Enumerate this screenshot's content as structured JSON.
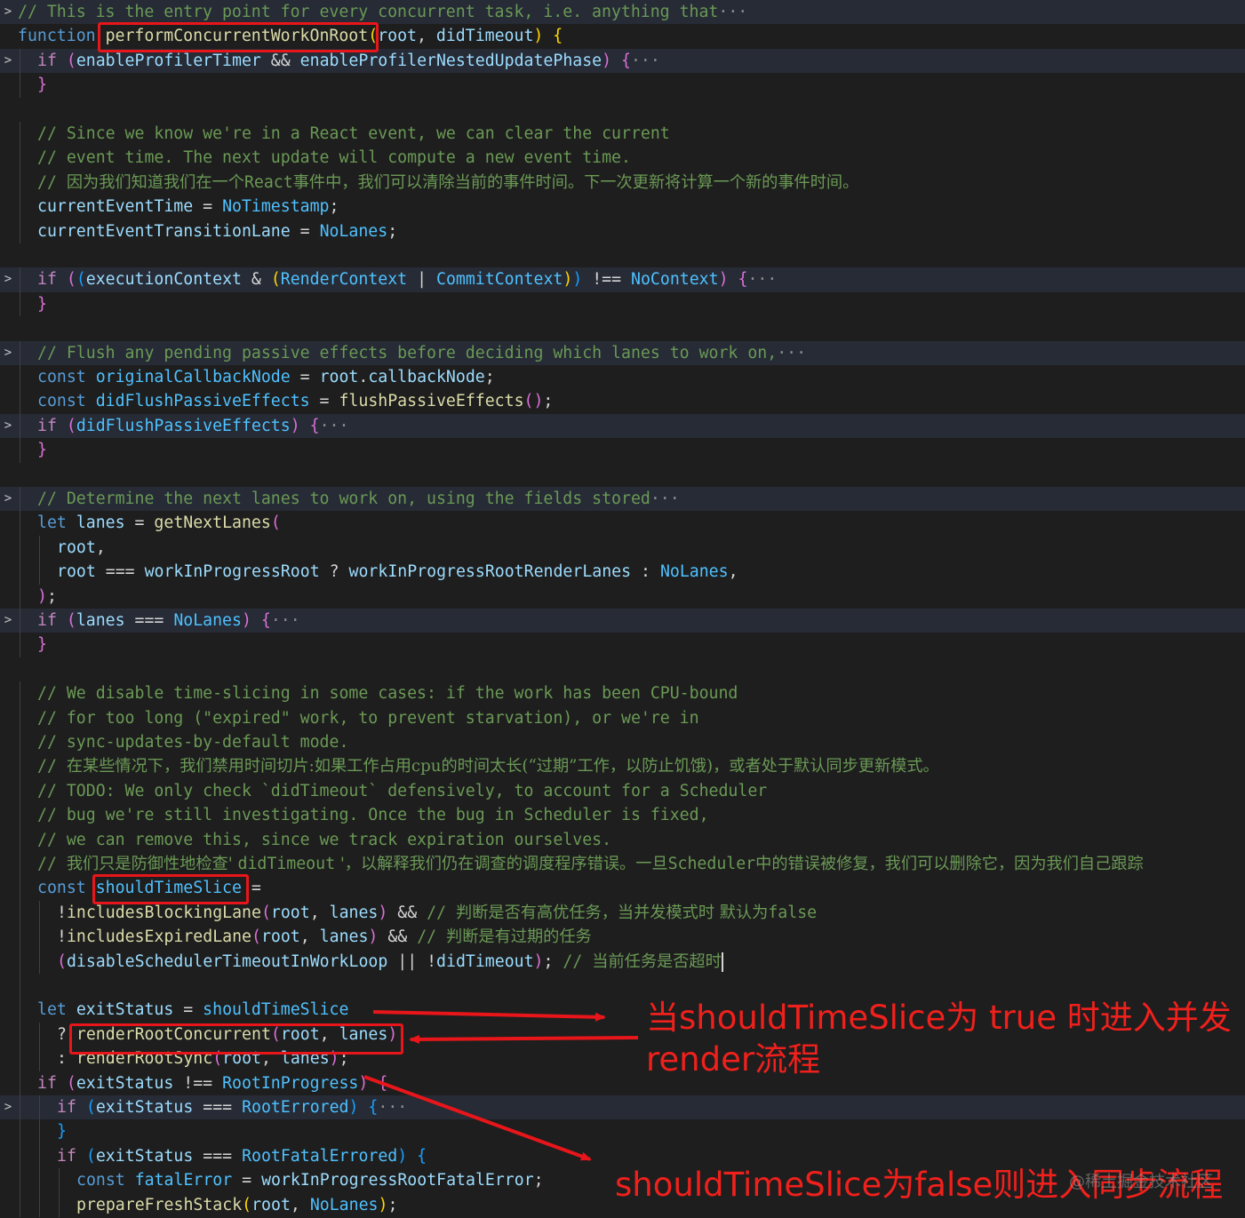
{
  "editor": {
    "lines": [
      {
        "gutter": ">",
        "fold": true,
        "indent": 0,
        "segments": [
          [
            "c",
            "// This is the entry point for every concurrent task, i.e. anything that"
          ],
          [
            "ell",
            "···"
          ]
        ]
      },
      {
        "gutter": "",
        "indent": 0,
        "segments": [
          [
            "k",
            "function "
          ],
          [
            "fn",
            "performConcurrentWorkOnRoot"
          ],
          [
            "b1",
            "("
          ],
          [
            "v",
            "root"
          ],
          [
            "p",
            ", "
          ],
          [
            "v",
            "didTimeout"
          ],
          [
            "b1",
            ")"
          ],
          [
            "p",
            " "
          ],
          [
            "b1",
            "{"
          ]
        ]
      },
      {
        "gutter": ">",
        "fold": true,
        "indent": 1,
        "segments": [
          [
            "kc",
            "if "
          ],
          [
            "b2",
            "("
          ],
          [
            "v",
            "enableProfilerTimer"
          ],
          [
            "p",
            " && "
          ],
          [
            "v",
            "enableProfilerNestedUpdatePhase"
          ],
          [
            "b2",
            ")"
          ],
          [
            "p",
            " "
          ],
          [
            "b2",
            "{"
          ],
          [
            "ell",
            "···"
          ]
        ]
      },
      {
        "gutter": "",
        "indent": 1,
        "segments": [
          [
            "b2",
            "}"
          ]
        ]
      },
      {
        "gutter": "",
        "indent": 0,
        "segments": []
      },
      {
        "gutter": "",
        "indent": 1,
        "segments": [
          [
            "c",
            "// Since we know we're in a React event, we can clear the current"
          ]
        ]
      },
      {
        "gutter": "",
        "indent": 1,
        "segments": [
          [
            "c",
            "// event time. The next update will compute a new event time."
          ]
        ]
      },
      {
        "gutter": "",
        "indent": 1,
        "segments": [
          [
            "c",
            "// "
          ],
          [
            "cz",
            "因为我们知道我们在一个"
          ],
          [
            "c",
            "React"
          ],
          [
            "cz",
            "事件中，我们可以清除当前的事件时间。下一次更新将计算一个新的事件时间。"
          ]
        ]
      },
      {
        "gutter": "",
        "indent": 1,
        "segments": [
          [
            "v",
            "currentEventTime"
          ],
          [
            "p",
            " = "
          ],
          [
            "cn",
            "NoTimestamp"
          ],
          [
            "p",
            ";"
          ]
        ]
      },
      {
        "gutter": "",
        "indent": 1,
        "segments": [
          [
            "v",
            "currentEventTransitionLane"
          ],
          [
            "p",
            " = "
          ],
          [
            "cn",
            "NoLanes"
          ],
          [
            "p",
            ";"
          ]
        ]
      },
      {
        "gutter": "",
        "indent": 0,
        "segments": []
      },
      {
        "gutter": ">",
        "fold": true,
        "indent": 1,
        "segments": [
          [
            "kc",
            "if "
          ],
          [
            "b2",
            "("
          ],
          [
            "b3",
            "("
          ],
          [
            "v",
            "executionContext"
          ],
          [
            "p",
            " & "
          ],
          [
            "b1",
            "("
          ],
          [
            "cn",
            "RenderContext"
          ],
          [
            "p",
            " | "
          ],
          [
            "cn",
            "CommitContext"
          ],
          [
            "b1",
            ")"
          ],
          [
            "b3",
            ")"
          ],
          [
            "p",
            " !== "
          ],
          [
            "cn",
            "NoContext"
          ],
          [
            "b2",
            ")"
          ],
          [
            "p",
            " "
          ],
          [
            "b2",
            "{"
          ],
          [
            "ell",
            "···"
          ]
        ]
      },
      {
        "gutter": "",
        "indent": 1,
        "segments": [
          [
            "b2",
            "}"
          ]
        ]
      },
      {
        "gutter": "",
        "indent": 0,
        "segments": []
      },
      {
        "gutter": ">",
        "fold": true,
        "indent": 1,
        "segments": [
          [
            "c",
            "// Flush any pending passive effects before deciding which lanes to work on,"
          ],
          [
            "ell",
            "···"
          ]
        ]
      },
      {
        "gutter": "",
        "indent": 1,
        "segments": [
          [
            "k",
            "const "
          ],
          [
            "cn",
            "originalCallbackNode"
          ],
          [
            "p",
            " = "
          ],
          [
            "v",
            "root"
          ],
          [
            "p",
            "."
          ],
          [
            "v",
            "callbackNode"
          ],
          [
            "p",
            ";"
          ]
        ]
      },
      {
        "gutter": "",
        "indent": 1,
        "segments": [
          [
            "k",
            "const "
          ],
          [
            "cn",
            "didFlushPassiveEffects"
          ],
          [
            "p",
            " = "
          ],
          [
            "fn",
            "flushPassiveEffects"
          ],
          [
            "b2",
            "()"
          ],
          [
            "p",
            ";"
          ]
        ]
      },
      {
        "gutter": ">",
        "fold": true,
        "indent": 1,
        "segments": [
          [
            "kc",
            "if "
          ],
          [
            "b2",
            "("
          ],
          [
            "cn",
            "didFlushPassiveEffects"
          ],
          [
            "b2",
            ")"
          ],
          [
            "p",
            " "
          ],
          [
            "b2",
            "{"
          ],
          [
            "ell",
            "···"
          ]
        ]
      },
      {
        "gutter": "",
        "indent": 1,
        "segments": [
          [
            "b2",
            "}"
          ]
        ]
      },
      {
        "gutter": "",
        "indent": 0,
        "segments": []
      },
      {
        "gutter": ">",
        "fold": true,
        "indent": 1,
        "segments": [
          [
            "c",
            "// Determine the next lanes to work on, using the fields stored"
          ],
          [
            "ell",
            "···"
          ]
        ]
      },
      {
        "gutter": "",
        "indent": 1,
        "segments": [
          [
            "k",
            "let "
          ],
          [
            "v",
            "lanes"
          ],
          [
            "p",
            " = "
          ],
          [
            "fn",
            "getNextLanes"
          ],
          [
            "b2",
            "("
          ]
        ]
      },
      {
        "gutter": "",
        "indent": 2,
        "segments": [
          [
            "v",
            "root"
          ],
          [
            "p",
            ","
          ]
        ]
      },
      {
        "gutter": "",
        "indent": 2,
        "segments": [
          [
            "v",
            "root"
          ],
          [
            "p",
            " === "
          ],
          [
            "v",
            "workInProgressRoot"
          ],
          [
            "p",
            " ? "
          ],
          [
            "v",
            "workInProgressRootRenderLanes"
          ],
          [
            "p",
            " : "
          ],
          [
            "cn",
            "NoLanes"
          ],
          [
            "p",
            ","
          ]
        ]
      },
      {
        "gutter": "",
        "indent": 1,
        "segments": [
          [
            "b2",
            ")"
          ],
          [
            "p",
            ";"
          ]
        ]
      },
      {
        "gutter": ">",
        "fold": true,
        "indent": 1,
        "segments": [
          [
            "kc",
            "if "
          ],
          [
            "b2",
            "("
          ],
          [
            "v",
            "lanes"
          ],
          [
            "p",
            " === "
          ],
          [
            "cn",
            "NoLanes"
          ],
          [
            "b2",
            ")"
          ],
          [
            "p",
            " "
          ],
          [
            "b2",
            "{"
          ],
          [
            "ell",
            "···"
          ]
        ]
      },
      {
        "gutter": "",
        "indent": 1,
        "segments": [
          [
            "b2",
            "}"
          ]
        ]
      },
      {
        "gutter": "",
        "indent": 0,
        "segments": []
      },
      {
        "gutter": "",
        "indent": 1,
        "segments": [
          [
            "c",
            "// We disable time-slicing in some cases: if the work has been CPU-bound"
          ]
        ]
      },
      {
        "gutter": "",
        "indent": 1,
        "segments": [
          [
            "c",
            "// for too long (\"expired\" work, to prevent starvation), or we're in"
          ]
        ]
      },
      {
        "gutter": "",
        "indent": 1,
        "segments": [
          [
            "c",
            "// sync-updates-by-default mode."
          ]
        ]
      },
      {
        "gutter": "",
        "indent": 1,
        "segments": [
          [
            "c",
            "// "
          ],
          [
            "cz",
            "在某些情况下，我们禁用时间切片:如果工作占用cpu的时间太长(“过期”工作，以防止饥饿)，或者处于默认同步更新模式。"
          ]
        ]
      },
      {
        "gutter": "",
        "indent": 1,
        "segments": [
          [
            "c",
            "// TODO: We only check `didTimeout` defensively, to account for a Scheduler"
          ]
        ]
      },
      {
        "gutter": "",
        "indent": 1,
        "segments": [
          [
            "c",
            "// bug we're still investigating. Once the bug in Scheduler is fixed,"
          ]
        ]
      },
      {
        "gutter": "",
        "indent": 1,
        "segments": [
          [
            "c",
            "// we can remove this, since we track expiration ourselves."
          ]
        ]
      },
      {
        "gutter": "",
        "indent": 1,
        "segments": [
          [
            "c",
            "// "
          ],
          [
            "cz",
            "我们只是防御性地检查' "
          ],
          [
            "c",
            "didTimeout"
          ],
          [
            "cz",
            " '，以解释我们仍在调查的调度程序错误。一旦"
          ],
          [
            "c",
            "Scheduler"
          ],
          [
            "cz",
            "中的错误被修复，我们可以删除它，因为我们自己跟踪"
          ]
        ]
      },
      {
        "gutter": "",
        "indent": 1,
        "segments": [
          [
            "k",
            "const "
          ],
          [
            "cn",
            "shouldTimeSlice"
          ],
          [
            "p",
            " ="
          ]
        ]
      },
      {
        "gutter": "",
        "indent": 2,
        "segments": [
          [
            "p",
            "!"
          ],
          [
            "fn",
            "includesBlockingLane"
          ],
          [
            "b2",
            "("
          ],
          [
            "v",
            "root"
          ],
          [
            "p",
            ", "
          ],
          [
            "v",
            "lanes"
          ],
          [
            "b2",
            ")"
          ],
          [
            "p",
            " && "
          ],
          [
            "c",
            "// "
          ],
          [
            "cz",
            "判断是否有高优任务，当并发模式时 默认为"
          ],
          [
            "c",
            "false"
          ]
        ]
      },
      {
        "gutter": "",
        "indent": 2,
        "segments": [
          [
            "p",
            "!"
          ],
          [
            "fn",
            "includesExpiredLane"
          ],
          [
            "b2",
            "("
          ],
          [
            "v",
            "root"
          ],
          [
            "p",
            ", "
          ],
          [
            "v",
            "lanes"
          ],
          [
            "b2",
            ")"
          ],
          [
            "p",
            " && "
          ],
          [
            "c",
            "// "
          ],
          [
            "cz",
            "判断是有过期的任务"
          ]
        ]
      },
      {
        "gutter": "",
        "indent": 2,
        "segments": [
          [
            "b2",
            "("
          ],
          [
            "v",
            "disableSchedulerTimeoutInWorkLoop"
          ],
          [
            "p",
            " || !"
          ],
          [
            "v",
            "didTimeout"
          ],
          [
            "b2",
            ")"
          ],
          [
            "p",
            "; "
          ],
          [
            "c",
            "// "
          ],
          [
            "cz",
            "当前任务是否超时"
          ]
        ],
        "cursor": true
      },
      {
        "gutter": "",
        "indent": 1,
        "segments": []
      },
      {
        "gutter": "",
        "indent": 1,
        "segments": [
          [
            "k",
            "let "
          ],
          [
            "v",
            "exitStatus"
          ],
          [
            "p",
            " = "
          ],
          [
            "cn",
            "shouldTimeSlice"
          ]
        ]
      },
      {
        "gutter": "",
        "indent": 2,
        "segments": [
          [
            "p",
            "? "
          ],
          [
            "fn",
            "renderRootConcurrent"
          ],
          [
            "b2",
            "("
          ],
          [
            "v",
            "root"
          ],
          [
            "p",
            ", "
          ],
          [
            "v",
            "lanes"
          ],
          [
            "b2",
            ")"
          ]
        ]
      },
      {
        "gutter": "",
        "indent": 2,
        "segments": [
          [
            "p",
            ": "
          ],
          [
            "fn",
            "renderRootSync"
          ],
          [
            "b2",
            "("
          ],
          [
            "v",
            "root"
          ],
          [
            "p",
            ", "
          ],
          [
            "v",
            "lanes"
          ],
          [
            "b2",
            ")"
          ],
          [
            "p",
            ";"
          ]
        ]
      },
      {
        "gutter": "",
        "indent": 1,
        "segments": [
          [
            "kc",
            "if "
          ],
          [
            "b2",
            "("
          ],
          [
            "v",
            "exitStatus"
          ],
          [
            "p",
            " !== "
          ],
          [
            "cn",
            "RootInProgress"
          ],
          [
            "b2",
            ")"
          ],
          [
            "p",
            " "
          ],
          [
            "b2",
            "{"
          ]
        ]
      },
      {
        "gutter": ">",
        "fold": true,
        "indent": 2,
        "segments": [
          [
            "kc",
            "if "
          ],
          [
            "b3",
            "("
          ],
          [
            "v",
            "exitStatus"
          ],
          [
            "p",
            " === "
          ],
          [
            "cn",
            "RootErrored"
          ],
          [
            "b3",
            ")"
          ],
          [
            "p",
            " "
          ],
          [
            "b3",
            "{"
          ],
          [
            "ell",
            "···"
          ]
        ]
      },
      {
        "gutter": "",
        "indent": 2,
        "segments": [
          [
            "b3",
            "}"
          ]
        ]
      },
      {
        "gutter": "",
        "indent": 2,
        "segments": [
          [
            "kc",
            "if "
          ],
          [
            "b3",
            "("
          ],
          [
            "v",
            "exitStatus"
          ],
          [
            "p",
            " === "
          ],
          [
            "cn",
            "RootFatalErrored"
          ],
          [
            "b3",
            ")"
          ],
          [
            "p",
            " "
          ],
          [
            "b3",
            "{"
          ]
        ]
      },
      {
        "gutter": "",
        "indent": 3,
        "segments": [
          [
            "k",
            "const "
          ],
          [
            "cn",
            "fatalError"
          ],
          [
            "p",
            " = "
          ],
          [
            "v",
            "workInProgressRootFatalError"
          ],
          [
            "p",
            ";"
          ]
        ]
      },
      {
        "gutter": "",
        "indent": 3,
        "segments": [
          [
            "fn",
            "prepareFreshStack"
          ],
          [
            "b1",
            "("
          ],
          [
            "v",
            "root"
          ],
          [
            "p",
            ", "
          ],
          [
            "cn",
            "NoLanes"
          ],
          [
            "b1",
            ")"
          ],
          [
            "p",
            ";"
          ]
        ]
      }
    ]
  },
  "annotations": {
    "note_concurrent_line1": "当shouldTimeSlice为 true 时进入并发",
    "note_concurrent_line2": "render流程",
    "note_sync": "shouldTimeSlice为false则进入同步流程",
    "watermark": "@稀土掘金技术社区"
  },
  "colors": {
    "background": "#1e1e1e",
    "highlight_box": "#e8161a",
    "annotation_text": "#f0201c",
    "comment": "#6a9955",
    "keyword": "#569cd6",
    "control_keyword": "#c586c0",
    "function": "#dcdcaa",
    "variable": "#9cdcfe",
    "constant": "#4fc1ff"
  },
  "icons": {
    "fold": "chevron-right-icon",
    "arrows": "arrow-right-icon"
  }
}
